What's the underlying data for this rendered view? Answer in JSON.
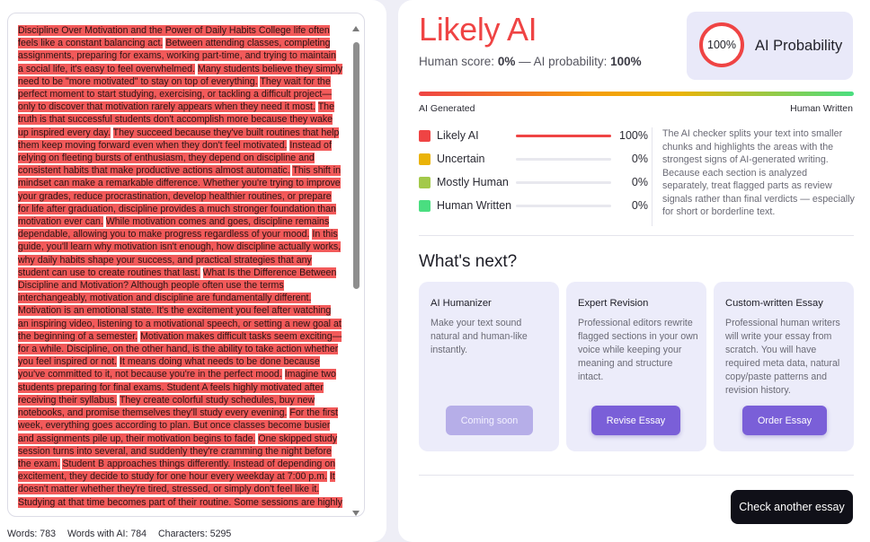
{
  "text_segments": [
    {
      "text": "Discipline Over Motivation and the Power of Daily Habits College life often feels like a constant balancing act.",
      "hl": true
    },
    {
      "text": " ",
      "hl": false
    },
    {
      "text": "Between attending classes, completing assignments, preparing for exams, working part-time, and trying to maintain a social life, it's easy to feel overwhelmed.",
      "hl": true
    },
    {
      "text": " ",
      "hl": false
    },
    {
      "text": "Many students believe they simply need to be \"more motivated\" to stay on top of everything.",
      "hl": true
    },
    {
      "text": " ",
      "hl": false
    },
    {
      "text": "They wait for the perfect moment to start studying, exercising, or tackling a difficult project—only to discover that motivation rarely appears when they need it most.",
      "hl": true
    },
    {
      "text": " ",
      "hl": false
    },
    {
      "text": "The truth is that successful students don't accomplish more because they wake up inspired every day.",
      "hl": true
    },
    {
      "text": " ",
      "hl": false
    },
    {
      "text": "They succeed because they've built routines that help them keep moving forward even when they don't feel motivated.",
      "hl": true
    },
    {
      "text": " ",
      "hl": false
    },
    {
      "text": "Instead of relying on fleeting bursts of enthusiasm, they depend on discipline and consistent habits that make productive actions almost automatic.",
      "hl": true
    },
    {
      "text": " ",
      "hl": false
    },
    {
      "text": "This shift in mindset can make a remarkable difference. Whether you're trying to improve your grades, reduce procrastination, develop healthier routines, or prepare for life after graduation, discipline provides a much stronger foundation than motivation ever can.",
      "hl": true
    },
    {
      "text": " ",
      "hl": false
    },
    {
      "text": "While motivation comes and goes, discipline remains dependable, allowing you to make progress regardless of your mood.",
      "hl": true
    },
    {
      "text": " ",
      "hl": false
    },
    {
      "text": "In this guide, you'll learn why motivation isn't enough, how discipline actually works, why daily habits shape your success, and practical strategies that any student can use to create routines that last.",
      "hl": true
    },
    {
      "text": " ",
      "hl": false
    },
    {
      "text": "What Is the Difference Between Discipline and Motivation? Although people often use the terms interchangeably, motivation and discipline are fundamentally different.",
      "hl": true
    },
    {
      "text": " ",
      "hl": false
    },
    {
      "text": "Motivation is an emotional state. It's the excitement you feel after watching an inspiring video, listening to a motivational speech, or setting a new goal at the beginning of a semester.",
      "hl": true
    },
    {
      "text": " ",
      "hl": false
    },
    {
      "text": "Motivation makes difficult tasks seem exciting—for a while. Discipline, on the other hand, is the ability to take action whether you feel inspired or not.",
      "hl": true
    },
    {
      "text": " ",
      "hl": false
    },
    {
      "text": "It means doing what needs to be done because you've committed to it, not because you're in the perfect mood.",
      "hl": true
    },
    {
      "text": " ",
      "hl": false
    },
    {
      "text": "Imagine two students preparing for final exams. Student A feels highly motivated after receiving their syllabus.",
      "hl": true
    },
    {
      "text": " ",
      "hl": false
    },
    {
      "text": "They create colorful study schedules, buy new notebooks, and promise themselves they'll study every evening.",
      "hl": true
    },
    {
      "text": " ",
      "hl": false
    },
    {
      "text": "For the first week, everything goes according to plan. But once classes become busier and assignments pile up, their motivation begins to fade.",
      "hl": true
    },
    {
      "text": " ",
      "hl": false
    },
    {
      "text": "One skipped study session turns into several, and suddenly they're cramming the night before the exam.",
      "hl": true
    },
    {
      "text": " ",
      "hl": false
    },
    {
      "text": "Student B approaches things differently. Instead of depending on excitement, they decide to study for one hour every weekday at 7:00 p.m.",
      "hl": true
    },
    {
      "text": " ",
      "hl": false
    },
    {
      "text": "It doesn't matter whether they're tired, stressed, or simply don't feel like it.",
      "hl": true
    },
    {
      "text": " ",
      "hl": false
    },
    {
      "text": "Studying at that time becomes part of their routine. Some sessions are highly",
      "hl": true
    }
  ],
  "stats": {
    "words": "Words: 783",
    "words_ai": "Words with AI: 784",
    "characters": "Characters: 5295"
  },
  "result": {
    "verdict": "Likely AI",
    "human_score_label": "Human score:",
    "human_score_value": "0%",
    "separator": " — ",
    "ai_prob_label": "AI probability:",
    "ai_prob_value": "100%",
    "ring_value": "100%",
    "ring_label": "AI Probability",
    "scale_left": "AI Generated",
    "scale_right": "Human Written",
    "ring_fraction": 1.0
  },
  "legend": [
    {
      "label": "Likely AI",
      "color": "#ef4444",
      "pct": "100%",
      "fraction": 1.0
    },
    {
      "label": "Uncertain",
      "color": "#eab308",
      "pct": "0%",
      "fraction": 0
    },
    {
      "label": "Mostly Human",
      "color": "#a3c94a",
      "pct": "0%",
      "fraction": 0
    },
    {
      "label": "Human Written",
      "color": "#4ade80",
      "pct": "0%",
      "fraction": 0
    }
  ],
  "explanation": "The AI checker splits your text into smaller chunks and highlights the areas with the strongest signs of AI-generated writing. Because each section is analyzed separately, treat flagged parts as review signals rather than final verdicts — especially for short or borderline text.",
  "next": {
    "heading": "What's next?",
    "cards": [
      {
        "title": "AI Humanizer",
        "desc": "Make your text sound natural and human-like instantly.",
        "button": "Coming soon",
        "enabled": false
      },
      {
        "title": "Expert Revision",
        "desc": "Professional editors rewrite flagged sections in your own voice while keeping your meaning and structure intact.",
        "button": "Revise Essay",
        "enabled": true
      },
      {
        "title": "Custom-written Essay",
        "desc": "Professional human writers will write your essay from scratch. You will have required meta data, natural copy/paste patterns and revision history.",
        "button": "Order Essay",
        "enabled": true
      }
    ]
  },
  "check_another": "Check another essay",
  "colors": {
    "accent": "#ef4444",
    "button": "#7a5fd8",
    "button_disabled": "#b6aee8",
    "dark_button": "#101018"
  }
}
